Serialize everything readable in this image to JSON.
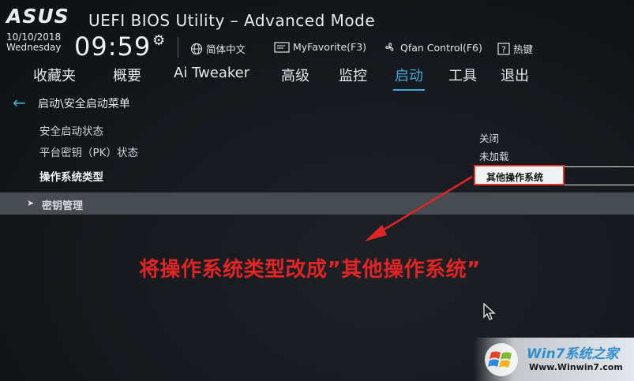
{
  "header": {
    "logo": "ASUS",
    "title": "UEFI BIOS Utility – Advanced Mode",
    "date": "10/10/2018",
    "weekday": "Wednesday",
    "time": "09:59",
    "language": "简体中文",
    "myfavorite": "MyFavorite(F3)",
    "qfan": "Qfan Control(F6)",
    "hotkeys": "热键"
  },
  "tabs": [
    {
      "label": "收藏夹"
    },
    {
      "label": "概要"
    },
    {
      "label": "Ai Tweaker"
    },
    {
      "label": "高级"
    },
    {
      "label": "监控"
    },
    {
      "label": "启动",
      "active": true
    },
    {
      "label": "工具"
    },
    {
      "label": "退出"
    }
  ],
  "breadcrumb": "启动\\安全启动菜单",
  "rows": [
    {
      "label": "安全启动状态",
      "value": "关闭"
    },
    {
      "label": "平台密钥（PK）状态",
      "value": "未加载"
    },
    {
      "label": "操作系统类型",
      "value": "其他操作系统"
    }
  ],
  "submenu": {
    "label": "密钥管理"
  },
  "annotation": "将操作系统类型改成”其他操作系统”",
  "watermark": {
    "title": "Win7系统之家",
    "url": "Www.Winwin7.com"
  },
  "colors": {
    "accent": "#3fa9d6",
    "annotation": "#e22424",
    "highlight_border": "#e0332f"
  }
}
